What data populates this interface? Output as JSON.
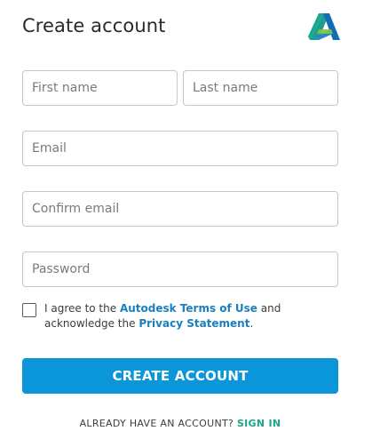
{
  "header": {
    "title": "Create account"
  },
  "form": {
    "first_name_placeholder": "First name",
    "last_name_placeholder": "Last name",
    "email_placeholder": "Email",
    "confirm_email_placeholder": "Confirm email",
    "password_placeholder": "Password"
  },
  "agreement": {
    "checked": false,
    "prefix": "I agree to the ",
    "terms_link": "Autodesk Terms of Use",
    "middle": " and acknowledge the ",
    "privacy_link": "Privacy Statement",
    "suffix": "."
  },
  "actions": {
    "create_label": "CREATE ACCOUNT",
    "already_text": "ALREADY HAVE AN ACCOUNT? ",
    "sign_in_label": "SIGN IN"
  },
  "colors": {
    "primary_button": "#0a96d8",
    "link": "#1a7fbd",
    "sign_in_link": "#1fa18a"
  },
  "icons": {
    "logo": "autodesk-logo-icon"
  }
}
